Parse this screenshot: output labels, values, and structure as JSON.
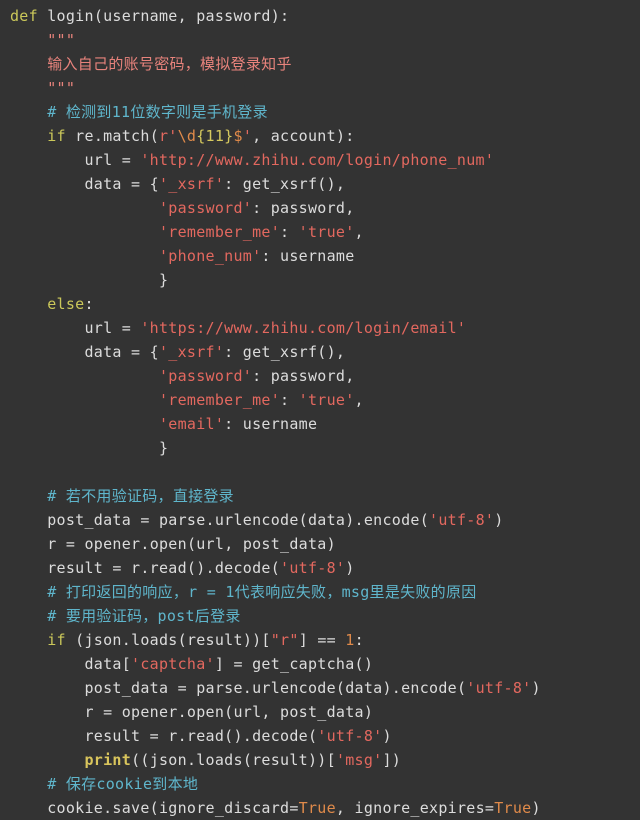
{
  "editor": {
    "language": "Python",
    "background_color": "#333333",
    "default_text_color": "#dcdcdc",
    "font_size_px": 15,
    "line_height_px": 24,
    "theme_colors": {
      "keyword": "#cbc85a",
      "string": "#e3685f",
      "docstring": "#e8837c",
      "comment": "#5fb6cc",
      "number": "#e08a4a",
      "constant": "#e08a4a",
      "builtin": "#d9c55c",
      "plain": "#dcdcdc"
    },
    "plain_text": "def login(username, password):\n    \"\"\"\n    输入自己的账号密码，模拟登录知乎\n    \"\"\"\n    # 检测到11位数字则是手机登录\n    if re.match(r'\\d{11}$', account):\n        url = 'http://www.zhihu.com/login/phone_num'\n        data = {'_xsrf': get_xsrf(),\n                'password': password,\n                'remember_me': 'true',\n                'phone_num': username\n                }\n    else:\n        url = 'https://www.zhihu.com/login/email'\n        data = {'_xsrf': get_xsrf(),\n                'password': password,\n                'remember_me': 'true',\n                'email': username\n                }\n\n    # 若不用验证码，直接登录\n    post_data = parse.urlencode(data).encode('utf-8')\n    r = opener.open(url, post_data)\n    result = r.read().decode('utf-8')\n    # 打印返回的响应，r = 1代表响应失败，msg里是失败的原因\n    # 要用验证码，post后登录\n    if (json.loads(result))[\"r\"] == 1:\n        data['captcha'] = get_captcha()\n        post_data = parse.urlencode(data).encode('utf-8')\n        r = opener.open(url, post_data)\n        result = r.read().decode('utf-8')\n        print((json.loads(result))['msg'])\n    # 保存cookie到本地\n    cookie.save(ignore_discard=True, ignore_expires=True)"
  },
  "lines": [
    {
      "n": 1,
      "tokens": [
        {
          "t": "def",
          "c": "kw"
        },
        {
          "t": " login",
          "c": "plain"
        },
        {
          "t": "(",
          "c": "punct"
        },
        {
          "t": "username",
          "c": "plain"
        },
        {
          "t": ", ",
          "c": "punct"
        },
        {
          "t": "password",
          "c": "plain"
        },
        {
          "t": "):",
          "c": "punct"
        }
      ]
    },
    {
      "n": 2,
      "tokens": [
        {
          "t": "    \"\"\"",
          "c": "doc"
        }
      ]
    },
    {
      "n": 3,
      "tokens": [
        {
          "t": "    输入自己的账号密码，模拟登录知乎",
          "c": "doc"
        }
      ]
    },
    {
      "n": 4,
      "tokens": [
        {
          "t": "    \"\"\"",
          "c": "doc"
        }
      ]
    },
    {
      "n": 5,
      "tokens": [
        {
          "t": "    # 检测到11位数字则是手机登录",
          "c": "comment"
        }
      ]
    },
    {
      "n": 6,
      "tokens": [
        {
          "t": "    ",
          "c": "plain"
        },
        {
          "t": "if",
          "c": "kw"
        },
        {
          "t": " re",
          "c": "plain"
        },
        {
          "t": ".",
          "c": "punct"
        },
        {
          "t": "match",
          "c": "plain"
        },
        {
          "t": "(",
          "c": "punct"
        },
        {
          "t": "r'",
          "c": "str"
        },
        {
          "t": "\\d",
          "c": "esc"
        },
        {
          "t": "{11}",
          "c": "rebrace"
        },
        {
          "t": "$",
          "c": "esc"
        },
        {
          "t": "'",
          "c": "str"
        },
        {
          "t": ", ",
          "c": "punct"
        },
        {
          "t": "account",
          "c": "plain"
        },
        {
          "t": "):",
          "c": "punct"
        }
      ]
    },
    {
      "n": 7,
      "tokens": [
        {
          "t": "        url ",
          "c": "plain"
        },
        {
          "t": "=",
          "c": "op"
        },
        {
          "t": " ",
          "c": "plain"
        },
        {
          "t": "'http://www.zhihu.com/login/phone_num'",
          "c": "str"
        }
      ]
    },
    {
      "n": 8,
      "tokens": [
        {
          "t": "        data ",
          "c": "plain"
        },
        {
          "t": "=",
          "c": "op"
        },
        {
          "t": " ",
          "c": "plain"
        },
        {
          "t": "{",
          "c": "punct"
        },
        {
          "t": "'_xsrf'",
          "c": "str"
        },
        {
          "t": ": ",
          "c": "punct"
        },
        {
          "t": "get_xsrf",
          "c": "plain"
        },
        {
          "t": "(),",
          "c": "punct"
        }
      ]
    },
    {
      "n": 9,
      "tokens": [
        {
          "t": "                ",
          "c": "plain"
        },
        {
          "t": "'password'",
          "c": "str"
        },
        {
          "t": ": ",
          "c": "punct"
        },
        {
          "t": "password",
          "c": "plain"
        },
        {
          "t": ",",
          "c": "punct"
        }
      ]
    },
    {
      "n": 10,
      "tokens": [
        {
          "t": "                ",
          "c": "plain"
        },
        {
          "t": "'remember_me'",
          "c": "str"
        },
        {
          "t": ": ",
          "c": "punct"
        },
        {
          "t": "'true'",
          "c": "str"
        },
        {
          "t": ",",
          "c": "punct"
        }
      ]
    },
    {
      "n": 11,
      "tokens": [
        {
          "t": "                ",
          "c": "plain"
        },
        {
          "t": "'phone_num'",
          "c": "str"
        },
        {
          "t": ": ",
          "c": "punct"
        },
        {
          "t": "username",
          "c": "plain"
        }
      ]
    },
    {
      "n": 12,
      "tokens": [
        {
          "t": "                ",
          "c": "plain"
        },
        {
          "t": "}",
          "c": "punct"
        }
      ]
    },
    {
      "n": 13,
      "tokens": [
        {
          "t": "    ",
          "c": "plain"
        },
        {
          "t": "else",
          "c": "kw"
        },
        {
          "t": ":",
          "c": "punct"
        }
      ]
    },
    {
      "n": 14,
      "tokens": [
        {
          "t": "        url ",
          "c": "plain"
        },
        {
          "t": "=",
          "c": "op"
        },
        {
          "t": " ",
          "c": "plain"
        },
        {
          "t": "'https://www.zhihu.com/login/email'",
          "c": "str"
        }
      ]
    },
    {
      "n": 15,
      "tokens": [
        {
          "t": "        data ",
          "c": "plain"
        },
        {
          "t": "=",
          "c": "op"
        },
        {
          "t": " ",
          "c": "plain"
        },
        {
          "t": "{",
          "c": "punct"
        },
        {
          "t": "'_xsrf'",
          "c": "str"
        },
        {
          "t": ": ",
          "c": "punct"
        },
        {
          "t": "get_xsrf",
          "c": "plain"
        },
        {
          "t": "(),",
          "c": "punct"
        }
      ]
    },
    {
      "n": 16,
      "tokens": [
        {
          "t": "                ",
          "c": "plain"
        },
        {
          "t": "'password'",
          "c": "str"
        },
        {
          "t": ": ",
          "c": "punct"
        },
        {
          "t": "password",
          "c": "plain"
        },
        {
          "t": ",",
          "c": "punct"
        }
      ]
    },
    {
      "n": 17,
      "tokens": [
        {
          "t": "                ",
          "c": "plain"
        },
        {
          "t": "'remember_me'",
          "c": "str"
        },
        {
          "t": ": ",
          "c": "punct"
        },
        {
          "t": "'true'",
          "c": "str"
        },
        {
          "t": ",",
          "c": "punct"
        }
      ]
    },
    {
      "n": 18,
      "tokens": [
        {
          "t": "                ",
          "c": "plain"
        },
        {
          "t": "'email'",
          "c": "str"
        },
        {
          "t": ": ",
          "c": "punct"
        },
        {
          "t": "username",
          "c": "plain"
        }
      ]
    },
    {
      "n": 19,
      "tokens": [
        {
          "t": "                ",
          "c": "plain"
        },
        {
          "t": "}",
          "c": "punct"
        }
      ]
    },
    {
      "n": 20,
      "tokens": [
        {
          "t": "",
          "c": "plain"
        }
      ]
    },
    {
      "n": 21,
      "tokens": [
        {
          "t": "    # 若不用验证码，直接登录",
          "c": "comment"
        }
      ]
    },
    {
      "n": 22,
      "tokens": [
        {
          "t": "    post_data ",
          "c": "plain"
        },
        {
          "t": "=",
          "c": "op"
        },
        {
          "t": " parse",
          "c": "plain"
        },
        {
          "t": ".",
          "c": "punct"
        },
        {
          "t": "urlencode",
          "c": "plain"
        },
        {
          "t": "(",
          "c": "punct"
        },
        {
          "t": "data",
          "c": "plain"
        },
        {
          "t": ").",
          "c": "punct"
        },
        {
          "t": "encode",
          "c": "plain"
        },
        {
          "t": "(",
          "c": "punct"
        },
        {
          "t": "'utf-8'",
          "c": "str"
        },
        {
          "t": ")",
          "c": "punct"
        }
      ]
    },
    {
      "n": 23,
      "tokens": [
        {
          "t": "    r ",
          "c": "plain"
        },
        {
          "t": "=",
          "c": "op"
        },
        {
          "t": " opener",
          "c": "plain"
        },
        {
          "t": ".",
          "c": "punct"
        },
        {
          "t": "open",
          "c": "plain"
        },
        {
          "t": "(",
          "c": "punct"
        },
        {
          "t": "url",
          "c": "plain"
        },
        {
          "t": ", ",
          "c": "punct"
        },
        {
          "t": "post_data",
          "c": "plain"
        },
        {
          "t": ")",
          "c": "punct"
        }
      ]
    },
    {
      "n": 24,
      "tokens": [
        {
          "t": "    result ",
          "c": "plain"
        },
        {
          "t": "=",
          "c": "op"
        },
        {
          "t": " r",
          "c": "plain"
        },
        {
          "t": ".",
          "c": "punct"
        },
        {
          "t": "read",
          "c": "plain"
        },
        {
          "t": "().",
          "c": "punct"
        },
        {
          "t": "decode",
          "c": "plain"
        },
        {
          "t": "(",
          "c": "punct"
        },
        {
          "t": "'utf-8'",
          "c": "str"
        },
        {
          "t": ")",
          "c": "punct"
        }
      ]
    },
    {
      "n": 25,
      "tokens": [
        {
          "t": "    # 打印返回的响应，r = 1代表响应失败，msg里是失败的原因",
          "c": "comment"
        }
      ]
    },
    {
      "n": 26,
      "tokens": [
        {
          "t": "    # 要用验证码，post后登录",
          "c": "comment"
        }
      ]
    },
    {
      "n": 27,
      "tokens": [
        {
          "t": "    ",
          "c": "plain"
        },
        {
          "t": "if",
          "c": "kw"
        },
        {
          "t": " (",
          "c": "punct"
        },
        {
          "t": "json",
          "c": "plain"
        },
        {
          "t": ".",
          "c": "punct"
        },
        {
          "t": "loads",
          "c": "plain"
        },
        {
          "t": "(",
          "c": "punct"
        },
        {
          "t": "result",
          "c": "plain"
        },
        {
          "t": "))[",
          "c": "punct"
        },
        {
          "t": "\"r\"",
          "c": "str"
        },
        {
          "t": "] ",
          "c": "punct"
        },
        {
          "t": "==",
          "c": "op"
        },
        {
          "t": " ",
          "c": "plain"
        },
        {
          "t": "1",
          "c": "num"
        },
        {
          "t": ":",
          "c": "punct"
        }
      ]
    },
    {
      "n": 28,
      "tokens": [
        {
          "t": "        data",
          "c": "plain"
        },
        {
          "t": "[",
          "c": "punct"
        },
        {
          "t": "'captcha'",
          "c": "str"
        },
        {
          "t": "] ",
          "c": "punct"
        },
        {
          "t": "=",
          "c": "op"
        },
        {
          "t": " get_captcha",
          "c": "plain"
        },
        {
          "t": "()",
          "c": "punct"
        }
      ]
    },
    {
      "n": 29,
      "tokens": [
        {
          "t": "        post_data ",
          "c": "plain"
        },
        {
          "t": "=",
          "c": "op"
        },
        {
          "t": " parse",
          "c": "plain"
        },
        {
          "t": ".",
          "c": "punct"
        },
        {
          "t": "urlencode",
          "c": "plain"
        },
        {
          "t": "(",
          "c": "punct"
        },
        {
          "t": "data",
          "c": "plain"
        },
        {
          "t": ").",
          "c": "punct"
        },
        {
          "t": "encode",
          "c": "plain"
        },
        {
          "t": "(",
          "c": "punct"
        },
        {
          "t": "'utf-8'",
          "c": "str"
        },
        {
          "t": ")",
          "c": "punct"
        }
      ]
    },
    {
      "n": 30,
      "tokens": [
        {
          "t": "        r ",
          "c": "plain"
        },
        {
          "t": "=",
          "c": "op"
        },
        {
          "t": " opener",
          "c": "plain"
        },
        {
          "t": ".",
          "c": "punct"
        },
        {
          "t": "open",
          "c": "plain"
        },
        {
          "t": "(",
          "c": "punct"
        },
        {
          "t": "url",
          "c": "plain"
        },
        {
          "t": ", ",
          "c": "punct"
        },
        {
          "t": "post_data",
          "c": "plain"
        },
        {
          "t": ")",
          "c": "punct"
        }
      ]
    },
    {
      "n": 31,
      "tokens": [
        {
          "t": "        result ",
          "c": "plain"
        },
        {
          "t": "=",
          "c": "op"
        },
        {
          "t": " r",
          "c": "plain"
        },
        {
          "t": ".",
          "c": "punct"
        },
        {
          "t": "read",
          "c": "plain"
        },
        {
          "t": "().",
          "c": "punct"
        },
        {
          "t": "decode",
          "c": "plain"
        },
        {
          "t": "(",
          "c": "punct"
        },
        {
          "t": "'utf-8'",
          "c": "str"
        },
        {
          "t": ")",
          "c": "punct"
        }
      ]
    },
    {
      "n": 32,
      "tokens": [
        {
          "t": "        ",
          "c": "plain"
        },
        {
          "t": "print",
          "c": "builtin"
        },
        {
          "t": "((",
          "c": "punct"
        },
        {
          "t": "json",
          "c": "plain"
        },
        {
          "t": ".",
          "c": "punct"
        },
        {
          "t": "loads",
          "c": "plain"
        },
        {
          "t": "(",
          "c": "punct"
        },
        {
          "t": "result",
          "c": "plain"
        },
        {
          "t": "))[",
          "c": "punct"
        },
        {
          "t": "'msg'",
          "c": "str"
        },
        {
          "t": "])",
          "c": "punct"
        }
      ]
    },
    {
      "n": 33,
      "tokens": [
        {
          "t": "    # 保存cookie到本地",
          "c": "comment"
        }
      ]
    },
    {
      "n": 34,
      "tokens": [
        {
          "t": "    cookie",
          "c": "plain"
        },
        {
          "t": ".",
          "c": "punct"
        },
        {
          "t": "save",
          "c": "plain"
        },
        {
          "t": "(",
          "c": "punct"
        },
        {
          "t": "ignore_discard",
          "c": "plain"
        },
        {
          "t": "=",
          "c": "op"
        },
        {
          "t": "True",
          "c": "const"
        },
        {
          "t": ", ",
          "c": "punct"
        },
        {
          "t": "ignore_expires",
          "c": "plain"
        },
        {
          "t": "=",
          "c": "op"
        },
        {
          "t": "True",
          "c": "const"
        },
        {
          "t": ")",
          "c": "punct"
        }
      ]
    }
  ]
}
